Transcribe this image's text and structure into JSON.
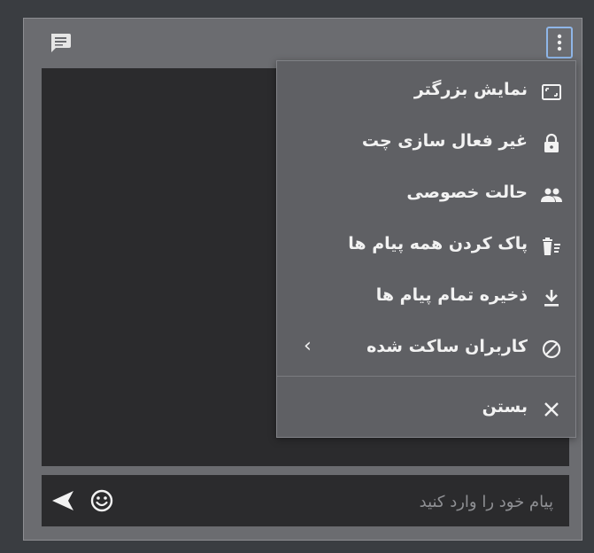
{
  "composer": {
    "placeholder": "پیام خود را وارد کنید"
  },
  "menu": {
    "items": [
      {
        "label": "نمایش بزرگتر",
        "icon": "fullscreen-icon"
      },
      {
        "label": "غیر فعال سازی چت",
        "icon": "lock-icon"
      },
      {
        "label": "حالت خصوصی",
        "icon": "people-icon"
      },
      {
        "label": "پاک کردن همه پیام ها",
        "icon": "clear-all-icon"
      },
      {
        "label": "ذخیره تمام پیام ها",
        "icon": "download-icon"
      },
      {
        "label": "کاربران ساکت شده",
        "icon": "block-icon",
        "has_submenu": true
      }
    ],
    "close_label": "بستن"
  },
  "colors": {
    "frame": "#3a3d41",
    "panel": "#6b6c70",
    "chat_area": "#2b2b2d",
    "menu_bg": "#5f6064",
    "focus_outline": "#8fb6e8",
    "text": "#f2f2f2"
  }
}
